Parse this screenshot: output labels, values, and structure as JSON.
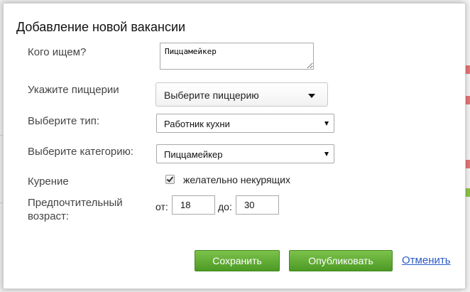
{
  "dialog": {
    "title": "Добавление новой вакансии"
  },
  "form": {
    "who_label": "Кого ищем?",
    "who_value": "Пиццамейкер",
    "pizzeria_label": "Укажите пиццерии",
    "pizzeria_value": "Выберите пиццерию",
    "type_label": "Выберите тип:",
    "type_value": "Работник кухни",
    "category_label": "Выберите категорию:",
    "category_value": "Пиццамейкер",
    "smoking_label": "Курение",
    "smoking_checked": true,
    "smoking_option": "желательно некурящих",
    "age_label_line1": "Предпочтительный",
    "age_label_line2": "возраст:",
    "age_from_label": "от:",
    "age_from_value": "18",
    "age_to_label": "до:",
    "age_to_value": "30"
  },
  "actions": {
    "save_label": "Сохранить",
    "publish_label": "Опубликовать",
    "cancel_label": "Отменить"
  },
  "colors": {
    "button_green": "#5aaa2f",
    "link_blue": "#2a5cc6",
    "bg_red_mark": "#e57373",
    "bg_green_mark": "#8bc34a"
  },
  "icons": {
    "dropdown": "caret-down",
    "checkbox": "checkmark"
  }
}
